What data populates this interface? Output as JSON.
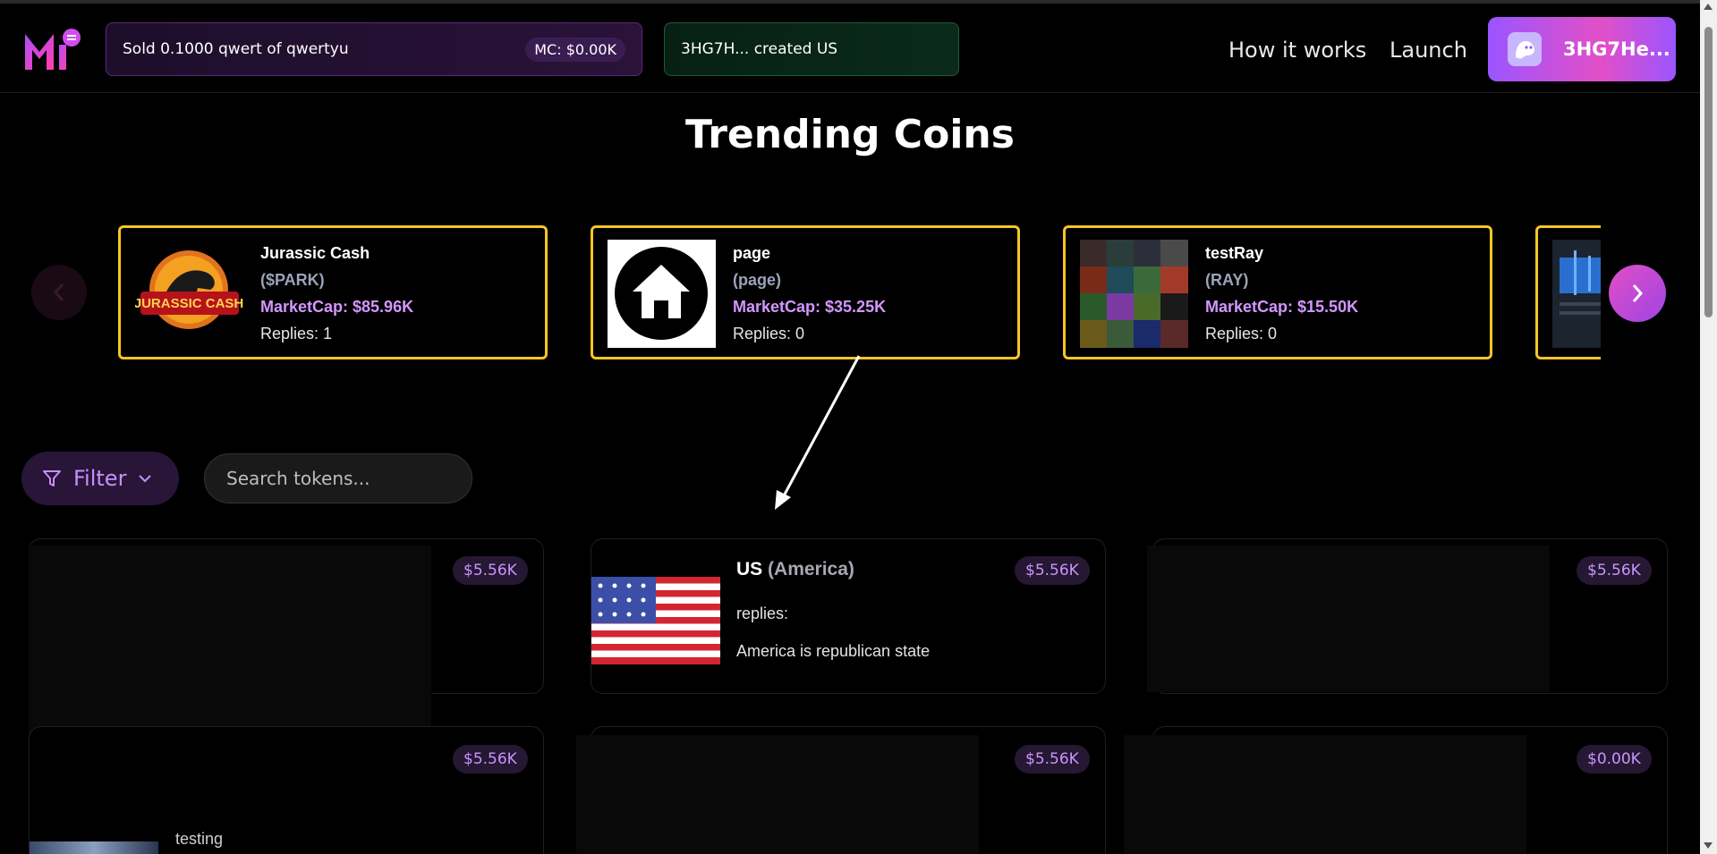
{
  "header": {
    "ticker_sell": {
      "text": "Sold 0.1000 qwert of qwertyu",
      "badge": "MC: $0.00K"
    },
    "ticker_create": {
      "text": "3HG7H... created US"
    },
    "nav": {
      "how_it_works": "How it works",
      "launch": "Launch"
    },
    "wallet": {
      "label": "3HG7He...",
      "icon": "ghost-icon"
    },
    "logo": "m-logo-icon"
  },
  "trending": {
    "title": "Trending Coins",
    "cards": [
      {
        "name": "Jurassic Cash",
        "symbol": "($PARK)",
        "market_cap": "MarketCap: $85.96K",
        "replies": "Replies: 1",
        "logo_text": "JURASSIC CASH"
      },
      {
        "name": "page",
        "symbol": "(page)",
        "market_cap": "MarketCap: $35.25K",
        "replies": "Replies: 0"
      },
      {
        "name": "testRay",
        "symbol": "(RAY)",
        "market_cap": "MarketCap: $15.50K",
        "replies": "Replies: 0"
      }
    ]
  },
  "controls": {
    "filter_label": "Filter",
    "search_placeholder": "Search tokens..."
  },
  "grid": {
    "cards": [
      {
        "market_cap": "$5.56K"
      },
      {
        "name": "US",
        "symbol": "(America)",
        "replies": "replies:",
        "description": "America is republican state",
        "market_cap": "$5.56K"
      },
      {
        "market_cap": "$5.56K"
      },
      {
        "market_cap": "$5.56K",
        "partial_text": "testing"
      },
      {
        "market_cap": "$5.56K"
      },
      {
        "market_cap": "$0.00K"
      }
    ]
  },
  "colors": {
    "accent": "#c78fff",
    "trending_border": "#f6c623",
    "market_cap": "#d397ff"
  }
}
